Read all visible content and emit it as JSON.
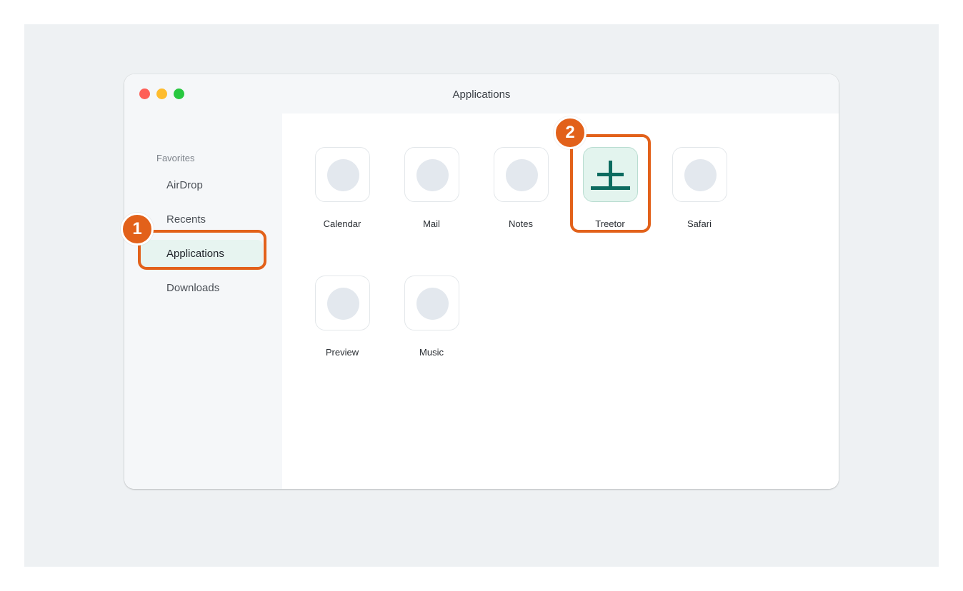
{
  "window": {
    "title": "Applications"
  },
  "sidebar": {
    "heading": "Favorites",
    "items": [
      {
        "label": "AirDrop"
      },
      {
        "label": "Recents"
      },
      {
        "label": "Applications",
        "selected": true
      },
      {
        "label": "Downloads"
      }
    ]
  },
  "apps": [
    {
      "label": "Calendar",
      "icon": "placeholder-circle-icon"
    },
    {
      "label": "Mail",
      "icon": "placeholder-circle-icon"
    },
    {
      "label": "Notes",
      "icon": "placeholder-circle-icon"
    },
    {
      "label": "Treetor",
      "icon": "treetor-app-icon"
    },
    {
      "label": "Safari",
      "icon": "placeholder-circle-icon"
    },
    {
      "label": "Preview",
      "icon": "placeholder-circle-icon"
    },
    {
      "label": "Music",
      "icon": "placeholder-circle-icon"
    }
  ],
  "annotations": [
    {
      "number": "1"
    },
    {
      "number": "2"
    }
  ],
  "colors": {
    "accent": "#e2611a",
    "treetor_icon": "#0c6b5f",
    "selected_bg": "#e7f4f0"
  }
}
